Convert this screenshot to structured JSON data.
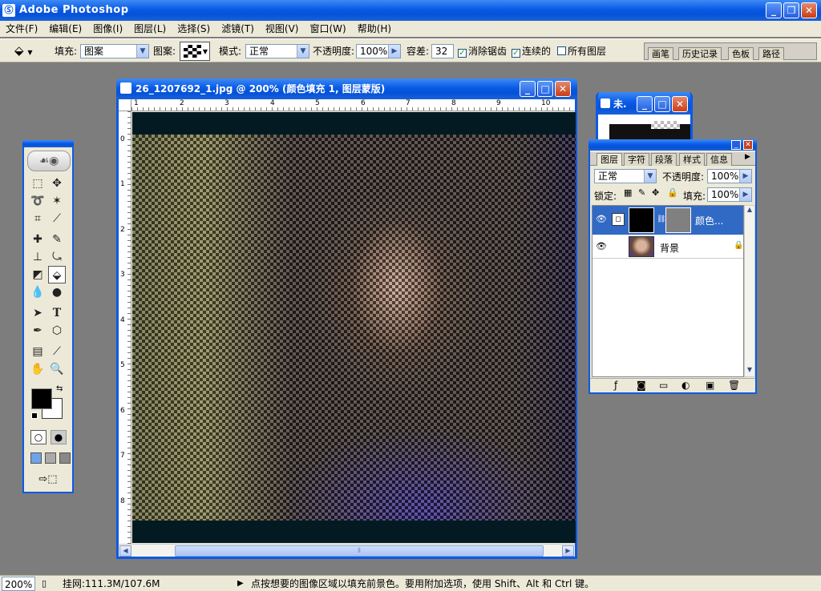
{
  "app": {
    "title": "Adobe Photoshop"
  },
  "menu": [
    "文件(F)",
    "编辑(E)",
    "图像(I)",
    "图层(L)",
    "选择(S)",
    "滤镜(T)",
    "视图(V)",
    "窗口(W)",
    "帮助(H)"
  ],
  "options": {
    "fill_label": "填充:",
    "fill_value": "图案",
    "pattern_label": "图案:",
    "mode_label": "模式:",
    "mode_value": "正常",
    "opacity_label": "不透明度:",
    "opacity_value": "100%",
    "tolerance_label": "容差:",
    "tolerance_value": "32",
    "antialias_label": "消除锯齿",
    "antialias_checked": true,
    "contiguous_label": "连续的",
    "contiguous_checked": true,
    "all_layers_label": "所有图层",
    "all_layers_checked": false
  },
  "palette_well": [
    "画笔",
    "历史记录",
    "色板",
    "路径"
  ],
  "document": {
    "title": "26_1207692_1.jpg @ 200% (颜色填充 1, 图层蒙版)",
    "ruler_h": [
      "1",
      "2",
      "3",
      "4",
      "5",
      "6",
      "7",
      "8",
      "9",
      "10"
    ],
    "ruler_v": [
      "0",
      "1",
      "2",
      "3",
      "4",
      "5",
      "6",
      "7",
      "8"
    ]
  },
  "navigator": {
    "title": "未."
  },
  "layers_panel": {
    "tabs": [
      "图层",
      "字符",
      "段落",
      "样式",
      "信息"
    ],
    "blend_mode": "正常",
    "opacity_label": "不透明度:",
    "opacity_value": "100%",
    "lock_label": "锁定:",
    "fill_label": "填充:",
    "fill_value": "100%",
    "layers": [
      {
        "name": "颜色...",
        "selected": true
      },
      {
        "name": "背景",
        "selected": false
      }
    ]
  },
  "status": {
    "zoom": "200%",
    "doc_size": "挂网:111.3M/107.6M",
    "hint": "点按想要的图像区域以填充前景色。要用附加选项，使用 Shift、Alt 和 Ctrl 键。"
  },
  "colors": {
    "titlebar": "#0a5ae6",
    "chrome": "#ece9d8",
    "workspace": "#7d7d7d"
  }
}
